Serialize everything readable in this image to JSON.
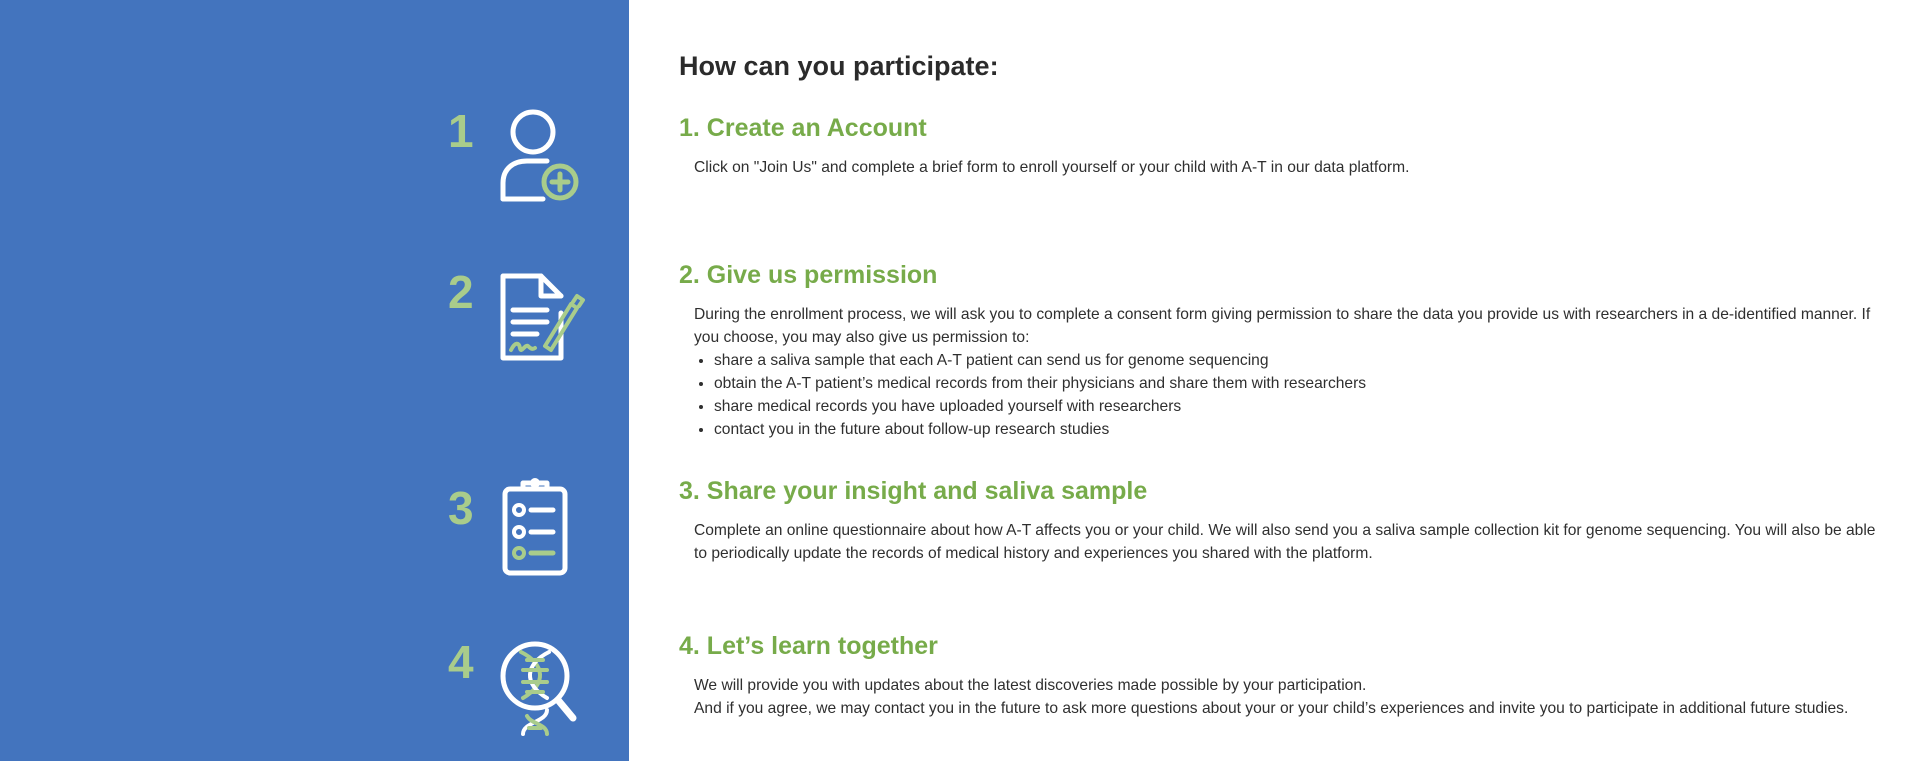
{
  "colors": {
    "panel_blue": "#4374be",
    "accent_green": "#77ab4a",
    "number_green": "#a9cc8b",
    "icon_white": "#ffffff"
  },
  "main_title": "How can you participate:",
  "steps": [
    {
      "number": "1",
      "icon": "user-add-icon",
      "title": "1. Create an Account",
      "paragraphs": [
        "Click on \"Join Us\" and complete a brief form to enroll yourself or your child with A-T in our data platform."
      ]
    },
    {
      "number": "2",
      "icon": "signed-document-icon",
      "title": "2. Give us permission",
      "paragraphs": [
        "During the enrollment process, we will ask you to complete a consent form giving permission to share the data you provide us with researchers in a de-identified manner. If you choose, you may also give us permission to:"
      ],
      "bullets": [
        "share a saliva sample that each A-T patient can send us for genome sequencing",
        "obtain the A-T patient’s medical records from their physicians and share them with researchers",
        "share medical records you have uploaded yourself with researchers",
        "contact you in the future about follow-up research studies"
      ]
    },
    {
      "number": "3",
      "icon": "clipboard-checklist-icon",
      "title": "3. Share your insight and saliva sample",
      "paragraphs": [
        "Complete an online questionnaire about how A-T affects you or your child. We will also send you a saliva sample collection kit for genome sequencing. You will also be able to periodically update the records of medical history and experiences you shared with the platform."
      ]
    },
    {
      "number": "4",
      "icon": "dna-magnifier-icon",
      "title": "4. Let’s learn together",
      "paragraphs": [
        "We will provide you with updates about the latest discoveries made possible by your participation.",
        "And if you agree, we may contact you in the future to ask more questions about your or your child’s experiences and invite you to participate in additional future studies."
      ]
    }
  ]
}
